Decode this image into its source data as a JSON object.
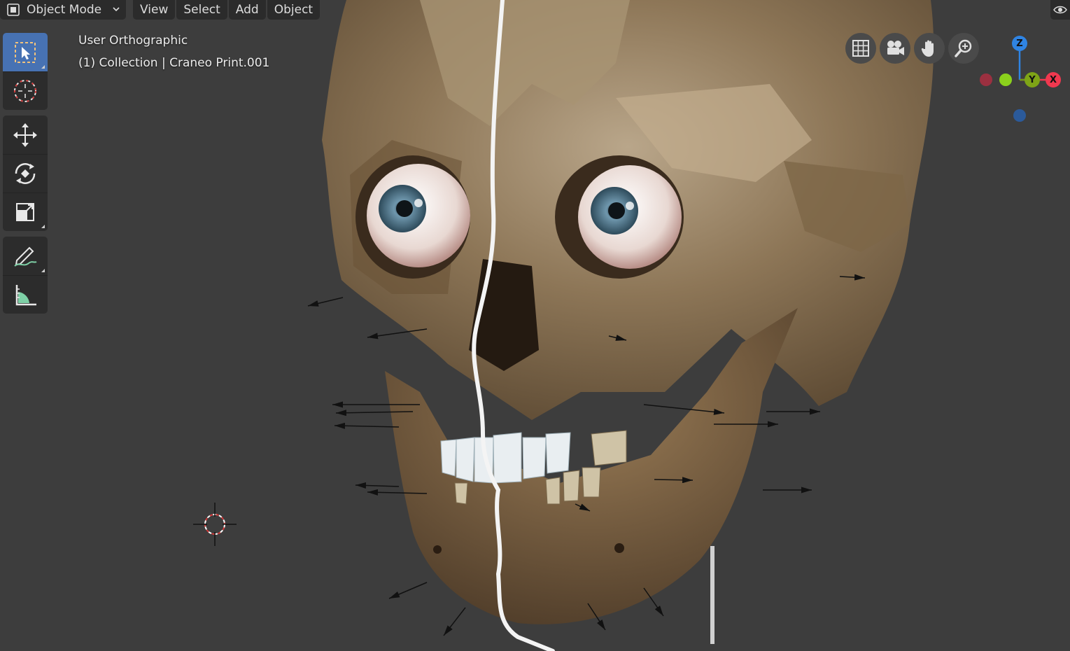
{
  "header": {
    "mode_label": "Object Mode",
    "menus": [
      "View",
      "Select",
      "Add",
      "Object"
    ]
  },
  "overlay": {
    "view_name": "User Orthographic",
    "collection_info": "(1) Collection | Craneo Print.001"
  },
  "toolbar": {
    "tools": [
      "select-box-icon",
      "cursor-icon",
      "move-icon",
      "rotate-icon",
      "scale-icon",
      "annotate-icon",
      "measure-icon"
    ],
    "active_tool": "select-box-icon"
  },
  "nav_buttons": [
    "grid-icon",
    "camera-icon",
    "hand-icon",
    "zoom-icon"
  ],
  "gizmo": {
    "labels": {
      "z": "Z",
      "y": "Y",
      "x": "X"
    },
    "colors": {
      "x": "#f0384f",
      "y": "#8bd11c",
      "z": "#2f84e3"
    }
  },
  "colors": {
    "background": "#3d3d3d",
    "header": "#2b2b2b",
    "accent": "#4772b3"
  }
}
